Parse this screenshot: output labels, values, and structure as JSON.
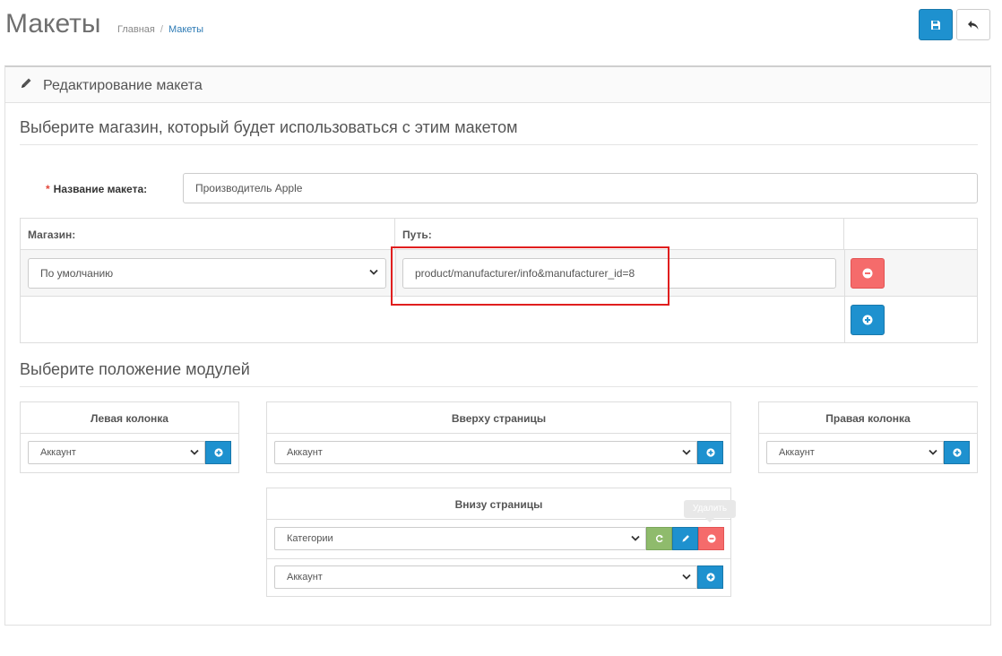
{
  "header": {
    "title": "Макеты",
    "breadcrumb": [
      {
        "label": "Главная"
      },
      {
        "label": "Макеты"
      }
    ],
    "buttons": {
      "save_icon": "save-icon",
      "back_icon": "reply-icon"
    }
  },
  "panel": {
    "title": "Редактирование макета",
    "title_icon": "pencil-icon"
  },
  "store_section": {
    "legend": "Выберите магазин, который будет использоваться с этим макетом",
    "name_label": "Название макета:",
    "name_value": "Производитель Apple",
    "table": {
      "headers": [
        "Магазин:",
        "Путь:",
        ""
      ],
      "rows": [
        {
          "store": "По умолчанию",
          "route": "product/manufacturer/info&manufacturer_id=8"
        }
      ]
    }
  },
  "modules_section": {
    "legend": "Выберите положение модулей",
    "left_column": {
      "title": "Левая колонка",
      "select": "Аккаунт"
    },
    "content_top": {
      "title": "Вверху страницы",
      "select": "Аккаунт"
    },
    "right_column": {
      "title": "Правая колонка",
      "select": "Аккаунт"
    },
    "content_bottom": {
      "title": "Внизу страницы",
      "modules": [
        {
          "value": "Категории"
        }
      ],
      "add_select": "Аккаунт",
      "tooltip": "Удалить"
    }
  },
  "colors": {
    "primary": "#1e91cf",
    "danger": "#f56b6b",
    "success": "#8fbb6c",
    "highlight": "#e01e1e"
  }
}
